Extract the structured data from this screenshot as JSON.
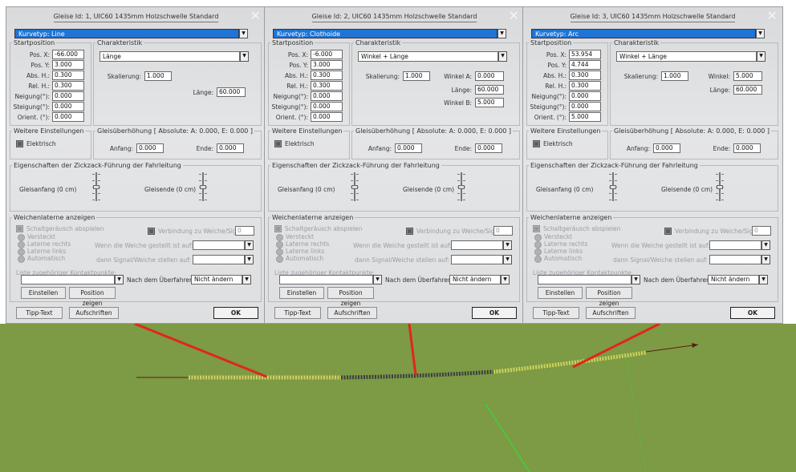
{
  "dialogs": [
    {
      "title": "Gleise Id: 1, UIC60 1435mm Holzschwelle Standard",
      "curve_type": "Kurvetyp: Line",
      "startposition": {
        "legend": "Startposition",
        "fields": [
          {
            "label": "Pos. X:",
            "value": "-66.000"
          },
          {
            "label": "Pos. Y:",
            "value": "3.000"
          },
          {
            "label": "Abs. H.:",
            "value": "0.300"
          },
          {
            "label": "Rel. H.:",
            "value": "0.300"
          },
          {
            "label": "Neigung(°):",
            "value": "0.000"
          },
          {
            "label": "Steigung(°):",
            "value": "0.000"
          },
          {
            "label": "Orient. (°):",
            "value": "0.000"
          }
        ]
      },
      "charakteristik": {
        "legend": "Charakteristik",
        "select": "Länge",
        "skalierung_label": "Skalierung:",
        "skalierung_value": "1.000",
        "params": [
          {
            "label": "Länge:",
            "value": "60.000"
          }
        ]
      },
      "weitere": {
        "legend": "Weitere Einstellungen",
        "elektrisch": "Elektrisch"
      },
      "gleisueberhoehung": {
        "legend": "Gleisüberhöhung [ Absolute: A: 0.000, E: 0.000 ]",
        "anfang_label": "Anfang:",
        "anfang_value": "0.000",
        "ende_label": "Ende:",
        "ende_value": "0.000"
      },
      "zickzack": {
        "legend": "Eigenschaften der Zickzack-Führung der Fahrleitung",
        "anfang": "Gleisanfang (0 cm)",
        "ende": "Gleisende (0 cm)"
      },
      "weiche": {
        "legend": "Weichenlaterne anzeigen",
        "schaltgeraeusch": "Schaltgeräusch abspielen",
        "verbindung": "Verbindung zu Weiche/Signal",
        "verbindung_value": "0",
        "radios": [
          "Versteckt",
          "Laterne rechts",
          "Laterne links",
          "Automatisch"
        ],
        "wenn": "Wenn die Weiche gestellt ist auf:",
        "dann": "dann Signal/Weiche stellen auf:",
        "kontakt": "Liste zugehöriger Kontaktpunkte:",
        "nach": "Nach dem Überfahren:",
        "nach_value": "Nicht ändern",
        "einstellen": "Einstellen",
        "position": "Position zeigen"
      },
      "footer": {
        "tipp": "Tipp-Text",
        "aufschriften": "Aufschriften",
        "ok": "OK"
      }
    },
    {
      "title": "Gleise Id: 2, UIC60 1435mm Holzschwelle Standard",
      "curve_type": "Kurvetyp: Clothoide",
      "startposition": {
        "legend": "Startposition",
        "fields": [
          {
            "label": "Pos. X:",
            "value": "-6.000"
          },
          {
            "label": "Pos. Y:",
            "value": "3.000"
          },
          {
            "label": "Abs. H.:",
            "value": "0.300"
          },
          {
            "label": "Rel. H.:",
            "value": "0.300"
          },
          {
            "label": "Neigung(°):",
            "value": "0.000"
          },
          {
            "label": "Steigung(°):",
            "value": "0.000"
          },
          {
            "label": "Orient. (°):",
            "value": "0.000"
          }
        ]
      },
      "charakteristik": {
        "legend": "Charakteristik",
        "select": "Winkel + Länge",
        "skalierung_label": "Skalierung:",
        "skalierung_value": "1.000",
        "params": [
          {
            "label": "Winkel A:",
            "value": "0.000"
          },
          {
            "label": "Länge:",
            "value": "60.000"
          },
          {
            "label": "Winkel B:",
            "value": "5.000"
          }
        ]
      },
      "weitere": {
        "legend": "Weitere Einstellungen",
        "elektrisch": "Elektrisch"
      },
      "gleisueberhoehung": {
        "legend": "Gleisüberhöhung [ Absolute: A: 0.000, E: 0.000 ]",
        "anfang_label": "Anfang:",
        "anfang_value": "0.000",
        "ende_label": "Ende:",
        "ende_value": "0.000"
      },
      "zickzack": {
        "legend": "Eigenschaften der Zickzack-Führung der Fahrleitung",
        "anfang": "Gleisanfang (0 cm)",
        "ende": "Gleisende (0 cm)"
      },
      "weiche": {
        "legend": "Weichenlaterne anzeigen",
        "schaltgeraeusch": "Schaltgeräusch abspielen",
        "verbindung": "Verbindung zu Weiche/Signal",
        "verbindung_value": "0",
        "radios": [
          "Versteckt",
          "Laterne rechts",
          "Laterne links",
          "Automatisch"
        ],
        "wenn": "Wenn die Weiche gestellt ist auf:",
        "dann": "dann Signal/Weiche stellen auf:",
        "kontakt": "Liste zugehöriger Kontaktpunkte:",
        "nach": "Nach dem Überfahren:",
        "nach_value": "Nicht ändern",
        "einstellen": "Einstellen",
        "position": "Position zeigen"
      },
      "footer": {
        "tipp": "Tipp-Text",
        "aufschriften": "Aufschriften",
        "ok": "OK"
      }
    },
    {
      "title": "Gleise Id: 3, UIC60 1435mm Holzschwelle Standard",
      "curve_type": "Kurvetyp: Arc",
      "startposition": {
        "legend": "Startposition",
        "fields": [
          {
            "label": "Pos. X:",
            "value": "53.954"
          },
          {
            "label": "Pos. Y:",
            "value": "4.744"
          },
          {
            "label": "Abs. H.:",
            "value": "0.300"
          },
          {
            "label": "Rel. H.:",
            "value": "0.300"
          },
          {
            "label": "Neigung(°):",
            "value": "0.000"
          },
          {
            "label": "Steigung(°):",
            "value": "0.000"
          },
          {
            "label": "Orient. (°):",
            "value": "5.000"
          }
        ]
      },
      "charakteristik": {
        "legend": "Charakteristik",
        "select": "Winkel + Länge",
        "skalierung_label": "Skalierung:",
        "skalierung_value": "1.000",
        "params": [
          {
            "label": "Winkel:",
            "value": "5.000"
          },
          {
            "label": "Länge:",
            "value": "60.000"
          }
        ]
      },
      "weitere": {
        "legend": "Weitere Einstellungen",
        "elektrisch": "Elektrisch"
      },
      "gleisueberhoehung": {
        "legend": "Gleisüberhöhung [ Absolute: A: 0.000, E: 0.000 ]",
        "anfang_label": "Anfang:",
        "anfang_value": "0.000",
        "ende_label": "Ende:",
        "ende_value": "0.000"
      },
      "zickzack": {
        "legend": "Eigenschaften der Zickzack-Führung der Fahrleitung",
        "anfang": "Gleisanfang (0 cm)",
        "ende": "Gleisende (0 cm)"
      },
      "weiche": {
        "legend": "Weichenlaterne anzeigen",
        "schaltgeraeusch": "Schaltgeräusch abspielen",
        "verbindung": "Verbindung zu Weiche/Signal",
        "verbindung_value": "0",
        "radios": [
          "Versteckt",
          "Laterne rechts",
          "Laterne links",
          "Automatisch"
        ],
        "wenn": "Wenn die Weiche gestellt ist auf:",
        "dann": "dann Signal/Weiche stellen auf:",
        "kontakt": "Liste zugehöriger Kontaktpunkte:",
        "nach": "Nach dem Überfahren:",
        "nach_value": "Nicht ändern",
        "einstellen": "Einstellen",
        "position": "Position zeigen"
      },
      "footer": {
        "tipp": "Tipp-Text",
        "aufschriften": "Aufschriften",
        "ok": "OK"
      }
    }
  ],
  "colors": {
    "curve_type_bg": "#1f74d6",
    "callout_line": "#e0261d",
    "track_segment_1": "#d8cf62",
    "track_segment_2": "#3a3f45",
    "track_segment_3": "#cfd35a",
    "ground": "#7d9a45",
    "axis_green": "#3fd23a",
    "direction_arrow": "#5a1f12"
  }
}
